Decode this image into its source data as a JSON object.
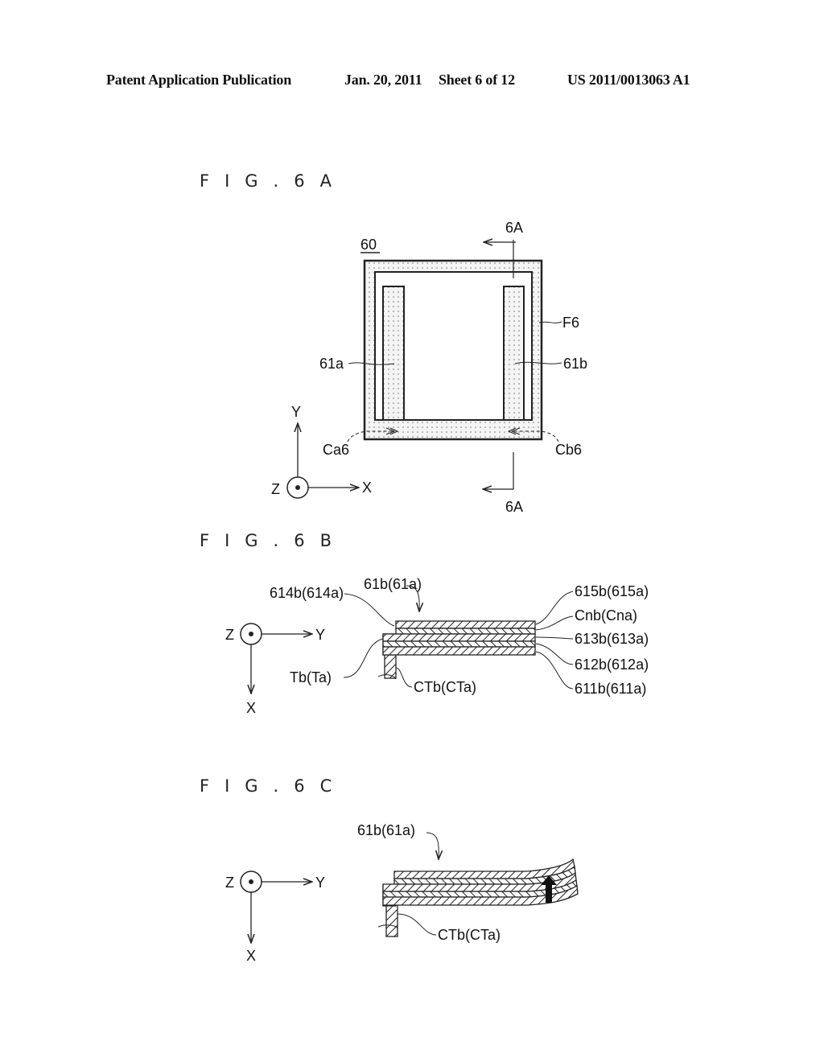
{
  "header": {
    "publication": "Patent Application Publication",
    "date": "Jan. 20, 2011",
    "sheet": "Sheet 6 of 12",
    "number": "US 2011/0013063 A1"
  },
  "figures": {
    "fig6a": {
      "title": "FIG.6A",
      "labels": {
        "device": "60",
        "section_top": "6A",
        "section_bottom": "6A",
        "frame": "F6",
        "left_arm": "61a",
        "right_arm": "61b",
        "left_corner": "Ca6",
        "right_corner": "Cb6",
        "axis_y": "Y",
        "axis_x": "X",
        "axis_z": "Z"
      }
    },
    "fig6b": {
      "title": "FIG.6B",
      "labels": {
        "arm": "61b(61a)",
        "layer_614": "614b(614a)",
        "layer_615": "615b(615a)",
        "layer_cn": "Cnb(Cna)",
        "layer_613": "613b(613a)",
        "layer_612": "612b(612a)",
        "layer_611": "611b(611a)",
        "terminal": "Tb(Ta)",
        "contact": "CTb(CTa)",
        "axis_z": "Z",
        "axis_y": "Y",
        "axis_x": "X"
      }
    },
    "fig6c": {
      "title": "FIG.6C",
      "labels": {
        "arm": "61b(61a)",
        "contact": "CTb(CTa)",
        "axis_z": "Z",
        "axis_y": "Y",
        "axis_x": "X"
      }
    }
  }
}
